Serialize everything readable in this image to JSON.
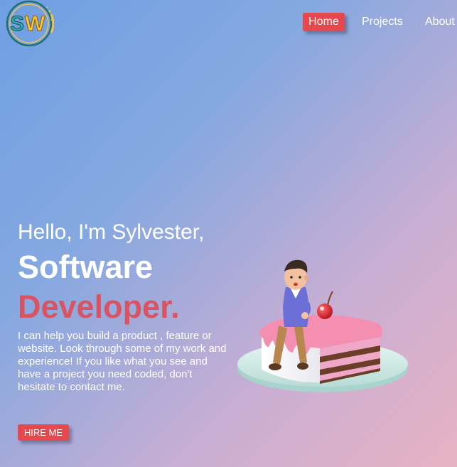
{
  "logo": {
    "text": "SW",
    "icon": "sw-logo"
  },
  "nav": {
    "items": [
      {
        "label": "Home",
        "active": true
      },
      {
        "label": "Projects",
        "active": false
      },
      {
        "label": "About",
        "active": false
      }
    ]
  },
  "hero": {
    "greeting": "Hello, I'm Sylvester,",
    "role_line1": "Software",
    "role_line2": "Developer.",
    "description": "I can help you build a product , feature or website. Look through some of my work and experience! If you like what you see and have a project you need coded, don't hesitate to contact me.",
    "cta_label": "HIRE ME"
  },
  "illustration": {
    "icon": "developer-on-cake-illustration"
  },
  "colors": {
    "accent": "#e5484d",
    "highlight_text": "#d95462",
    "gradient_start": "#6f9fe3",
    "gradient_end": "#e7b2c2"
  }
}
